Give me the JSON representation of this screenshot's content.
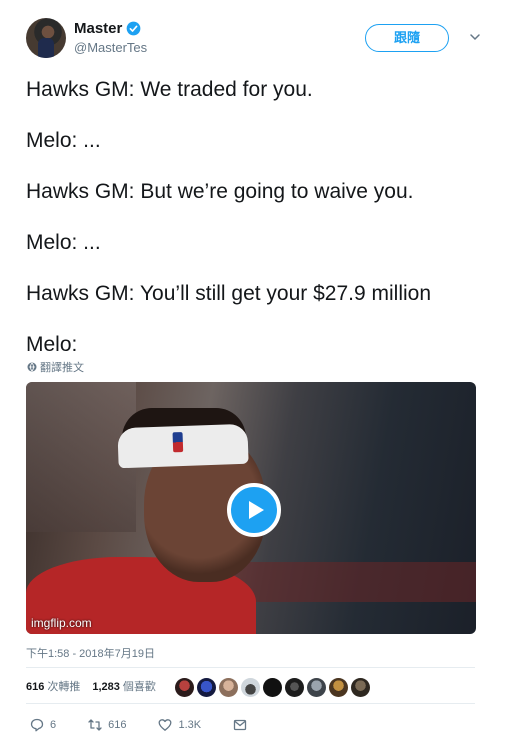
{
  "author": {
    "display_name": "Master",
    "handle": "@MasterTes",
    "verified": true
  },
  "header": {
    "follow_label": "跟隨",
    "caret_icon": "chevron-down-icon"
  },
  "tweet": {
    "lines": [
      "Hawks GM: We traded for you.",
      "Melo: ...",
      "Hawks GM: But we’re going to waive you.",
      "Melo: ...",
      "Hawks GM: You’ll still get your $27.9 million",
      "Melo:"
    ],
    "translate_label": "翻譯推文"
  },
  "media": {
    "watermark": "imgflip.com",
    "play_icon": "play-icon"
  },
  "timestamp": "下午1:58 - 2018年7月19日",
  "stats": {
    "retweets_count": "616",
    "retweets_label": "次轉推",
    "likes_count": "1,283",
    "likes_label": "個喜歡"
  },
  "actions": {
    "replies": "6",
    "retweets": "616",
    "likes": "1.3K"
  },
  "colors": {
    "accent": "#1da1f2",
    "text": "#14171a",
    "muted": "#657786"
  }
}
